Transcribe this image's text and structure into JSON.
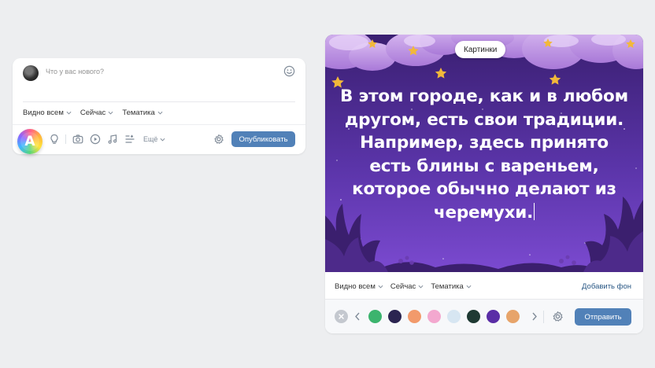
{
  "composer": {
    "placeholder": "Что у вас нового?",
    "visibility": "Видно всем",
    "time": "Сейчас",
    "topic": "Тематика",
    "more": "Ещё",
    "publish": "Опубликовать",
    "badge_letter": "A",
    "tools": [
      "lightbulb-icon",
      "camera-icon",
      "video-icon",
      "music-icon",
      "poll-icon"
    ]
  },
  "editor": {
    "background_pill": "Картинки",
    "poster_text": "В этом городе, как и в любом другом, есть свои традиции. Например, здесь принято есть блины с вареньем, которое обычно делают из черемухи.",
    "visibility": "Видно всем",
    "time": "Сейчас",
    "topic": "Тематика",
    "add_background": "Добавить фон",
    "send": "Отправить",
    "backgrounds": [
      {
        "name": "green-leaf",
        "color": "#3cb46e"
      },
      {
        "name": "night-sky",
        "color": "#2b2450"
      },
      {
        "name": "peach",
        "color": "#f29a6b"
      },
      {
        "name": "pink-bubbles",
        "color": "#f3a8cf"
      },
      {
        "name": "unicorn",
        "color": "#d7e6f2"
      },
      {
        "name": "dark-green-star",
        "color": "#1f3a33"
      },
      {
        "name": "purple-rocket",
        "color": "#5a2ea6"
      },
      {
        "name": "autumn",
        "color": "#e7a46a"
      }
    ]
  },
  "colors": {
    "accent": "#5181b8",
    "page_bg": "#edeef0",
    "poster_top": "#3a1f71",
    "poster_bottom": "#7b4ad0"
  }
}
